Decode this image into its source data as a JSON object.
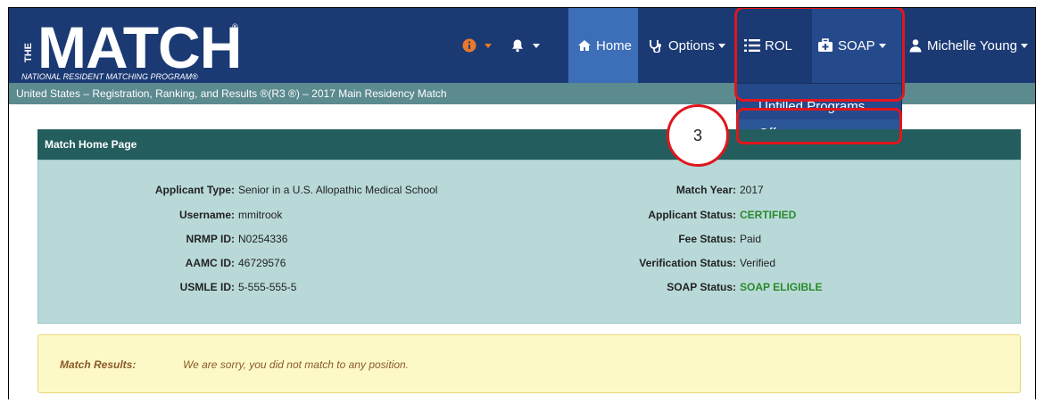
{
  "logo": {
    "the": "THE",
    "main": "MATCH",
    "reg": "®",
    "sub": "NATIONAL RESIDENT MATCHING PROGRAM®"
  },
  "nav": {
    "info_icon": "info-icon",
    "bell_icon": "bell-icon",
    "home_label": "Home",
    "options_label": "Options",
    "rol_label": "ROL",
    "soap_label": "SOAP",
    "user_label": "Michelle Young"
  },
  "breadcrumb": "United States  –  Registration, Ranking, and Results ®(R3 ®)  –  2017 Main Residency Match",
  "soap_menu": {
    "items": [
      {
        "label": "Unfilled Programs"
      },
      {
        "label": "Offers"
      }
    ]
  },
  "annotation": {
    "step": "3"
  },
  "panel": {
    "title": "Match Home Page",
    "left": [
      {
        "label": "Applicant Type:",
        "value": "Senior in a U.S. Allopathic Medical School"
      },
      {
        "label": "Username:",
        "value": "mmitrook"
      },
      {
        "label": "NRMP ID:",
        "value": "N0254336"
      },
      {
        "label": "AAMC ID:",
        "value": "46729576"
      },
      {
        "label": "USMLE ID:",
        "value": "5-555-555-5"
      }
    ],
    "right": [
      {
        "label": "Match Year:",
        "value": "2017"
      },
      {
        "label": "Applicant Status:",
        "value": "CERTIFIED"
      },
      {
        "label": "Fee Status:",
        "value": "Paid"
      },
      {
        "label": "Verification Status:",
        "value": "Verified"
      },
      {
        "label": "SOAP Status:",
        "value": "SOAP ELIGIBLE"
      }
    ]
  },
  "results": {
    "label": "Match Results:",
    "value": "We are sorry, you did not match to any position."
  },
  "colors": {
    "navbar": "#1b3a74",
    "home_active": "#3d6fb8",
    "highlight": "#e0161d",
    "panel_head": "#245d5d",
    "panel_body": "#b9d9d9",
    "status_green": "#2a8a2a"
  }
}
